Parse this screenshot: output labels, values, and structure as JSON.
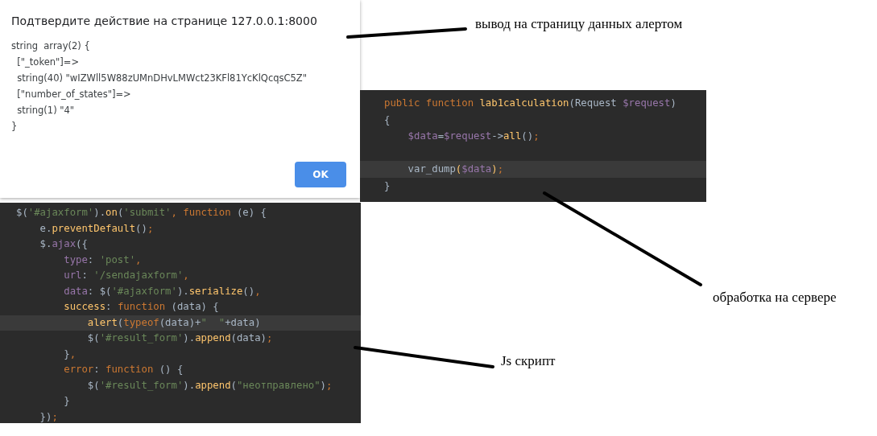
{
  "alert_dialog": {
    "title": "Подтвердите действие на странице 127.0.0.1:8000",
    "message_lines": [
      "string  array(2) {",
      "  [\"_token\"]=>",
      "  string(40) \"wIZWll5W88zUMnDHvLMWct23KFl81YcKlQcqsC5Z\"",
      "  [\"number_of_states\"]=>",
      "  string(1) \"4\"",
      "}"
    ],
    "buttons": [
      "OK"
    ]
  },
  "php_editor": {
    "lines": [
      {
        "current": false,
        "tokens": [
          {
            "kind": "kw",
            "text": "public function "
          },
          {
            "kind": "fn",
            "text": "lab1calculation"
          },
          {
            "kind": "plain",
            "text": "(Request "
          },
          {
            "kind": "var",
            "text": "$request"
          },
          {
            "kind": "plain",
            "text": ")"
          }
        ]
      },
      {
        "current": false,
        "tokens": [
          {
            "kind": "plain",
            "text": "{"
          }
        ]
      },
      {
        "current": false,
        "tokens": [
          {
            "kind": "var",
            "text": "    $data"
          },
          {
            "kind": "plain",
            "text": "="
          },
          {
            "kind": "var",
            "text": "$request"
          },
          {
            "kind": "plain",
            "text": "->"
          },
          {
            "kind": "fn",
            "text": "all"
          },
          {
            "kind": "plain",
            "text": "()"
          },
          {
            "kind": "kw",
            "text": ";"
          }
        ]
      },
      {
        "current": false
      },
      {
        "current": true,
        "tokens": [
          {
            "kind": "plain",
            "text": "    var_dump"
          },
          {
            "kind": "fn",
            "text": "("
          },
          {
            "kind": "var",
            "text": "$data"
          },
          {
            "kind": "fn",
            "text": ")"
          },
          {
            "kind": "kw",
            "text": ";"
          }
        ]
      },
      {
        "current": false,
        "tokens": [
          {
            "kind": "plain",
            "text": "}"
          }
        ]
      }
    ]
  },
  "js_editor": {
    "lines": [
      {
        "current": false,
        "tokens": [
          {
            "kind": "plain",
            "text": "$("
          },
          {
            "kind": "str",
            "text": "'#ajaxform'"
          },
          {
            "kind": "plain",
            "text": ")."
          },
          {
            "kind": "fn",
            "text": "on"
          },
          {
            "kind": "plain",
            "text": "("
          },
          {
            "kind": "str",
            "text": "'submit'"
          },
          {
            "kind": "kw",
            "text": ", function "
          },
          {
            "kind": "plain",
            "text": "(e) {"
          }
        ]
      },
      {
        "current": false,
        "tokens": [
          {
            "kind": "plain",
            "text": "    e."
          },
          {
            "kind": "fn",
            "text": "preventDefault"
          },
          {
            "kind": "plain",
            "text": "()"
          },
          {
            "kind": "kw",
            "text": ";"
          }
        ]
      },
      {
        "current": false,
        "tokens": [
          {
            "kind": "plain",
            "text": "    $."
          },
          {
            "kind": "var",
            "text": "ajax"
          },
          {
            "kind": "plain",
            "text": "({"
          }
        ]
      },
      {
        "current": false,
        "tokens": [
          {
            "kind": "var",
            "text": "        type"
          },
          {
            "kind": "plain",
            "text": ": "
          },
          {
            "kind": "str",
            "text": "'post'"
          },
          {
            "kind": "kw",
            "text": ","
          }
        ]
      },
      {
        "current": false,
        "tokens": [
          {
            "kind": "var",
            "text": "        url"
          },
          {
            "kind": "plain",
            "text": ": "
          },
          {
            "kind": "str",
            "text": "'/sendajaxform'"
          },
          {
            "kind": "kw",
            "text": ","
          }
        ]
      },
      {
        "current": false,
        "tokens": [
          {
            "kind": "var",
            "text": "        data"
          },
          {
            "kind": "plain",
            "text": ": $("
          },
          {
            "kind": "str",
            "text": "'#ajaxform'"
          },
          {
            "kind": "plain",
            "text": ")."
          },
          {
            "kind": "fn",
            "text": "serialize"
          },
          {
            "kind": "plain",
            "text": "()"
          },
          {
            "kind": "kw",
            "text": ","
          }
        ]
      },
      {
        "current": false,
        "tokens": [
          {
            "kind": "fn",
            "text": "        success"
          },
          {
            "kind": "plain",
            "text": ": "
          },
          {
            "kind": "kw",
            "text": "function "
          },
          {
            "kind": "plain",
            "text": "(data) {"
          }
        ]
      },
      {
        "current": true,
        "tokens": [
          {
            "kind": "fn",
            "text": "            alert"
          },
          {
            "kind": "plain",
            "text": "("
          },
          {
            "kind": "kw",
            "text": "typeof"
          },
          {
            "kind": "plain",
            "text": "(data)+"
          },
          {
            "kind": "str",
            "text": "\"  \""
          },
          {
            "kind": "plain",
            "text": "+data)"
          }
        ]
      },
      {
        "current": false,
        "tokens": [
          {
            "kind": "plain",
            "text": "            $("
          },
          {
            "kind": "str",
            "text": "'#result_form'"
          },
          {
            "kind": "plain",
            "text": ")."
          },
          {
            "kind": "fn",
            "text": "append"
          },
          {
            "kind": "plain",
            "text": "(data)"
          },
          {
            "kind": "kw",
            "text": ";"
          }
        ]
      },
      {
        "current": false,
        "tokens": [
          {
            "kind": "plain",
            "text": "        }"
          },
          {
            "kind": "kw",
            "text": ","
          }
        ]
      },
      {
        "current": false,
        "tokens": [
          {
            "kind": "kw",
            "text": "        error"
          },
          {
            "kind": "plain",
            "text": ": "
          },
          {
            "kind": "kw",
            "text": "function "
          },
          {
            "kind": "plain",
            "text": "() {"
          }
        ]
      },
      {
        "current": false,
        "tokens": [
          {
            "kind": "plain",
            "text": "            $("
          },
          {
            "kind": "str",
            "text": "'#result_form'"
          },
          {
            "kind": "plain",
            "text": ")."
          },
          {
            "kind": "fn",
            "text": "append"
          },
          {
            "kind": "plain",
            "text": "("
          },
          {
            "kind": "str",
            "text": "\"неотправлено\""
          },
          {
            "kind": "plain",
            "text": ")"
          },
          {
            "kind": "kw",
            "text": ";"
          }
        ]
      },
      {
        "current": false,
        "tokens": [
          {
            "kind": "plain",
            "text": "        }"
          }
        ]
      },
      {
        "current": false,
        "tokens": [
          {
            "kind": "plain",
            "text": "    })"
          },
          {
            "kind": "kw",
            "text": ";"
          }
        ]
      }
    ]
  },
  "annotations": [
    "вывод на страницу данных алертом",
    "обработка на сервере",
    "Js скрипт"
  ]
}
